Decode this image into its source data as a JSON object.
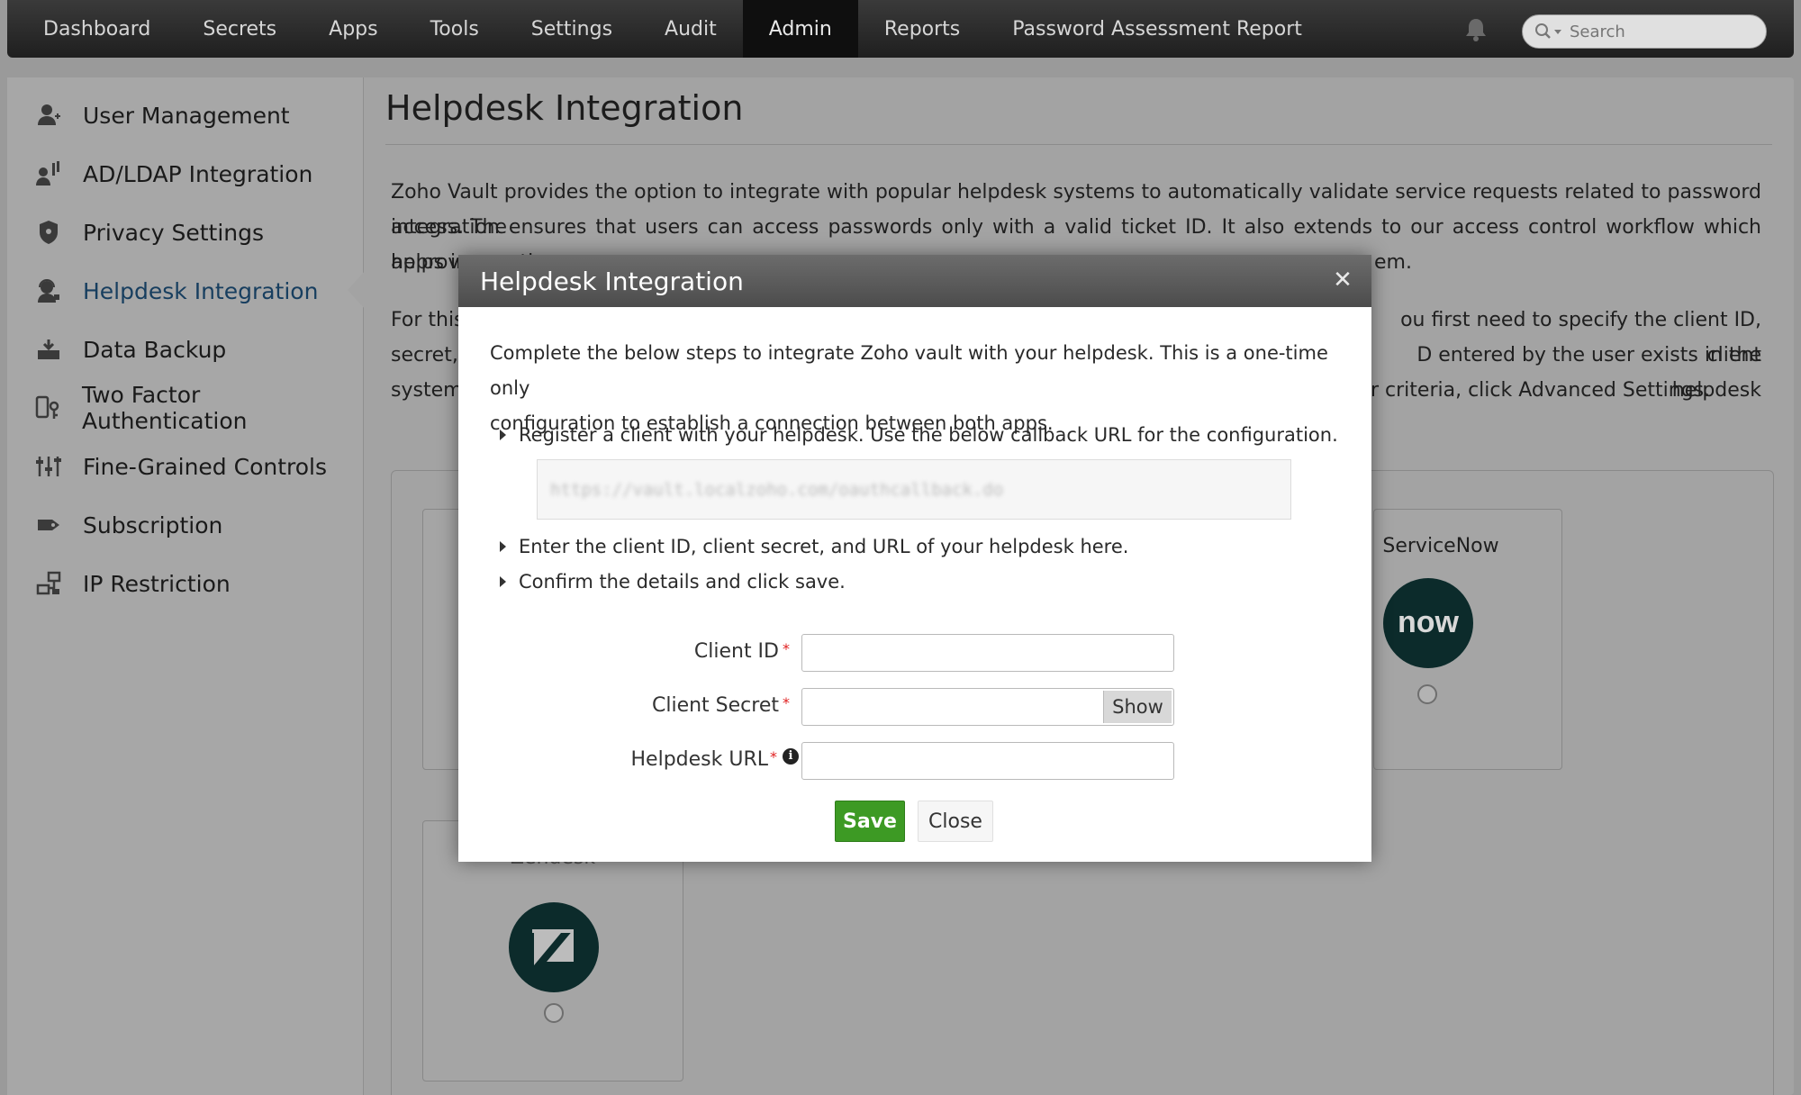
{
  "nav": {
    "items": [
      "Dashboard",
      "Secrets",
      "Apps",
      "Tools",
      "Settings",
      "Audit",
      "Admin",
      "Reports",
      "Password Assessment Report"
    ],
    "active": "Admin",
    "search_placeholder": "Search"
  },
  "sidebar": {
    "items": [
      {
        "label": "User Management",
        "icon": "user-icon"
      },
      {
        "label": "AD/LDAP Integration",
        "icon": "directory-icon"
      },
      {
        "label": "Privacy Settings",
        "icon": "shield-icon"
      },
      {
        "label": "Helpdesk Integration",
        "icon": "headset-icon"
      },
      {
        "label": "Data Backup",
        "icon": "backup-icon"
      },
      {
        "label": "Two Factor Authentication",
        "icon": "two-factor-icon"
      },
      {
        "label": "Fine-Grained Controls",
        "icon": "sliders-icon"
      },
      {
        "label": "Subscription",
        "icon": "tag-icon"
      },
      {
        "label": "IP Restriction",
        "icon": "network-icon"
      }
    ],
    "active_index": 3,
    "active_color": "#173e5f"
  },
  "main": {
    "title": "Helpdesk Integration",
    "para1_line1": "Zoho Vault provides the option to integrate with popular helpdesk systems to automatically validate service requests related to password access. The",
    "para1_line2": "integration ensures that users can access passwords only with a valid ticket ID. It also extends to our access control workflow which helps in granting",
    "para1_line3_start": "approva",
    "para1_line3_end": "em.",
    "para2_line1_start": "For this",
    "para2_line1_end": "ou first need to specify the client ID, client",
    "para2_line2_start": "secret, a",
    "para2_line2_end": "D entered by the user exists in the helpdesk",
    "para2_line3_start": "system",
    "para2_line3_end": "r criteria, click Advanced Settings.",
    "cards": [
      {
        "name": "ServiceNow",
        "logo_text": "now"
      },
      {
        "name": "Zendesk",
        "logo_text": "Z"
      }
    ]
  },
  "modal": {
    "title": "Helpdesk Integration",
    "intro_line1": "Complete the below steps to integrate Zoho vault with your helpdesk. This is a one-time only",
    "intro_line2": "configuration to establish a connection between both apps.",
    "step1": "Register a client with your helpdesk. Use the below callback URL for the configuration.",
    "callback_url": "https://vault.localzoho.com/oauthcallback.do",
    "step2": "Enter the client ID, client secret, and URL of your helpdesk here.",
    "step3": "Confirm the details and click save.",
    "fields": {
      "client_id_label": "Client ID",
      "client_secret_label": "Client Secret",
      "helpdesk_url_label": "Helpdesk URL",
      "required_mark": "*",
      "show_label": "Show"
    },
    "save_label": "Save",
    "close_label": "Close",
    "save_color": "#3d9a24"
  }
}
